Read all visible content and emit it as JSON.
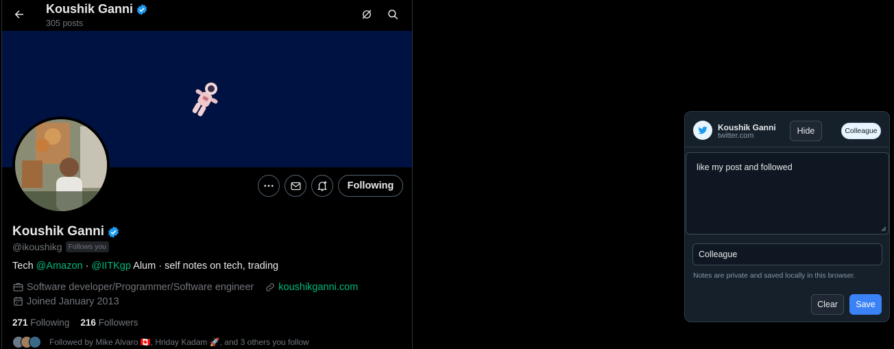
{
  "header": {
    "name": "Koushik Ganni",
    "posts": "305 posts"
  },
  "profile": {
    "name": "Koushik Ganni",
    "handle": "@ikoushikg",
    "follows_you": "Follows you",
    "bio": {
      "prefix": "Tech ",
      "mention1": "@Amazon",
      "sep": " · ",
      "mention2": "@IITKgp",
      "suffix": " Alum · self notes on  tech, trading"
    },
    "profession": "Software developer/Programmer/Software engineer",
    "website": "koushikganni.com",
    "joined": "Joined January 2013",
    "following_count": "271",
    "following_label": "Following",
    "followers_count": "216",
    "followers_label": "Followers",
    "followed_by": "Followed by Mike Alvaro 🇨🇦, Hriday Kadam 🚀, and 3 others you follow",
    "follow_button": "Following"
  },
  "notes_popup": {
    "name": "Koushik Ganni",
    "site": "twitter.com",
    "hide_label": "Hide",
    "tag_pill": "Colleague",
    "note_text": "like my post and followed",
    "tag_value": "Colleague",
    "privacy_text": "Notes are private and saved locally in this browser.",
    "clear_label": "Clear",
    "save_label": "Save"
  },
  "colors": {
    "background": "#000000",
    "banner": "#001241",
    "verified": "#1d9bf0",
    "link": "#00ba7c",
    "popup_bg": "#15202b",
    "save_button": "#3b82f6"
  },
  "icons": [
    "back-arrow-icon",
    "grok-icon",
    "search-icon",
    "more-icon",
    "message-icon",
    "notification-bell-icon",
    "verified-badge-icon",
    "briefcase-icon",
    "link-icon",
    "calendar-icon",
    "twitter-bird-icon"
  ]
}
